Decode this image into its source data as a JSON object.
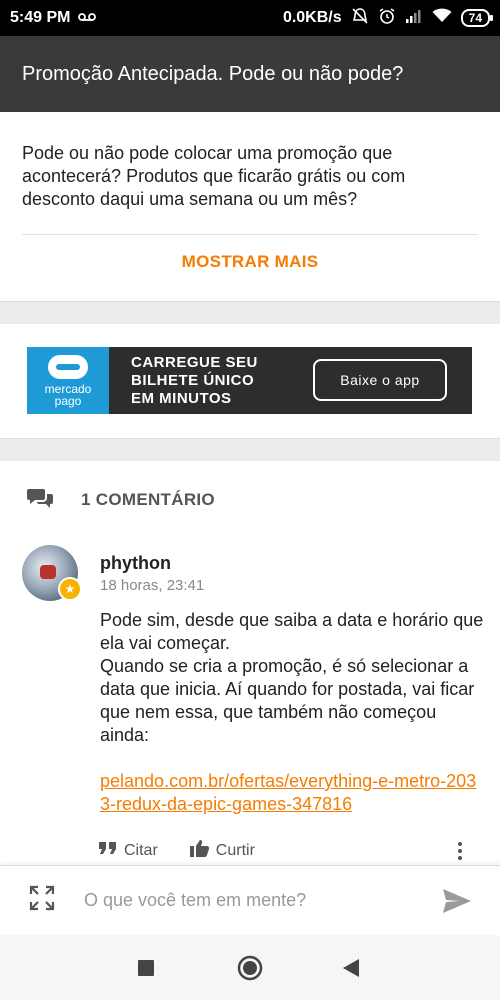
{
  "status_bar": {
    "time": "5:49 PM",
    "speed": "0.0KB/s",
    "battery": "74"
  },
  "header": {
    "title": "Promoção Antecipada. Pode ou não pode?"
  },
  "topic": {
    "description": "Pode ou não pode colocar uma promoção que acontecerá? Produtos que ficarão grátis ou com desconto daqui uma semana ou um mês?",
    "show_more_label": "MOSTRAR MAIS"
  },
  "ad": {
    "brand_line1": "mercado",
    "brand_line2": "pago",
    "headline_line1": "CARREGUE SEU",
    "headline_line2": "BILHETE ÚNICO",
    "headline_line3": "EM MINUTOS",
    "button_label": "Baixe o app"
  },
  "comments": {
    "count_label": "1 COMENTÁRIO",
    "items": [
      {
        "author": "phython",
        "time": "18 horas, 23:41",
        "body_line1": "Pode sim, desde que saiba a data e horário que ela vai começar.",
        "body_line2": "Quando se cria a promoção, é só selecionar a data que inicia. Aí quando for postada, vai ficar que nem essa, que também não começou ainda:",
        "link": "pelando.com.br/ofertas/everything-e-metro-2033-redux-da-epic-games-347816",
        "quote_label": "Citar",
        "like_label": "Curtir"
      }
    ]
  },
  "composer": {
    "placeholder": "O que você tem em mente?"
  },
  "colors": {
    "accent": "#f57c00",
    "title_bar": "#3a3a3a"
  },
  "icons": [
    "voicemail-icon",
    "alarm-off-icon",
    "alarm-icon",
    "signal-icon",
    "wifi-icon",
    "battery-icon",
    "comments-icon",
    "quote-icon",
    "thumbs-up-icon",
    "more-vert-icon",
    "expand-icon",
    "send-icon",
    "square-icon",
    "circle-icon",
    "back-icon"
  ]
}
